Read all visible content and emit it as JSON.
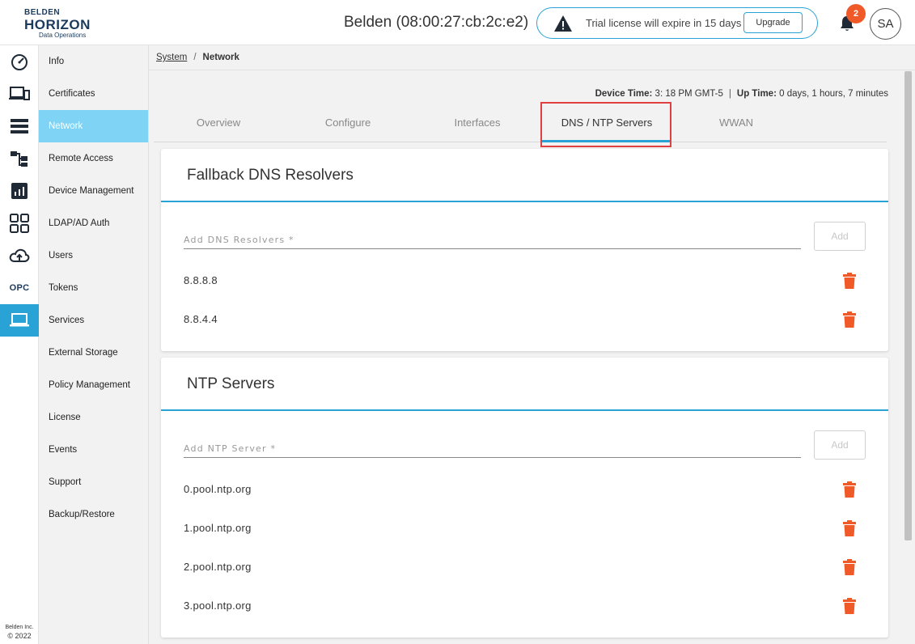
{
  "header": {
    "logo_line1": "BELDEN",
    "logo_line2": "HORIZON",
    "logo_tagline": "Data Operations",
    "device_title": "Belden (08:00:27:cb:2c:e2)",
    "trial_text": "Trial license will expire in 15 days",
    "upgrade_label": "Upgrade",
    "notification_count": "2",
    "avatar_initials": "SA",
    "accent_color": "#29a3d6",
    "badge_color": "#f05a28"
  },
  "rail": {
    "icons": [
      "dashboard-icon",
      "devices-icon",
      "list-icon",
      "topology-icon",
      "analytics-icon",
      "apps-grid-icon",
      "cloud-upload-icon",
      "opc-icon",
      "laptop-icon"
    ],
    "opc_label": "OPC",
    "footer_company": "Belden Inc.",
    "footer_copyright": "© 2022"
  },
  "sidebar": {
    "items": [
      {
        "label": "Info"
      },
      {
        "label": "Certificates"
      },
      {
        "label": "Network"
      },
      {
        "label": "Remote Access"
      },
      {
        "label": "Device Management"
      },
      {
        "label": "LDAP/AD Auth"
      },
      {
        "label": "Users"
      },
      {
        "label": "Tokens"
      },
      {
        "label": "Services"
      },
      {
        "label": "External Storage"
      },
      {
        "label": "Policy Management"
      },
      {
        "label": "License"
      },
      {
        "label": "Events"
      },
      {
        "label": "Support"
      },
      {
        "label": "Backup/Restore"
      }
    ],
    "active": "Network"
  },
  "breadcrumb": {
    "parent": "System",
    "separator": "/",
    "current": "Network"
  },
  "status": {
    "device_time_label": "Device Time:",
    "device_time_value": "3: 18 PM GMT-5",
    "separator": "|",
    "uptime_label": "Up Time:",
    "uptime_value": "0 days, 1 hours, 7 minutes"
  },
  "tabs": [
    {
      "label": "Overview"
    },
    {
      "label": "Configure"
    },
    {
      "label": "Interfaces"
    },
    {
      "label": "DNS / NTP Servers"
    },
    {
      "label": "WWAN"
    }
  ],
  "active_tab": "DNS / NTP Servers",
  "dns": {
    "title": "Fallback DNS Resolvers",
    "placeholder": "Add DNS Resolvers *",
    "add_label": "Add",
    "entries": [
      "8.8.8.8",
      "8.8.4.4"
    ]
  },
  "ntp": {
    "title": "NTP Servers",
    "placeholder": "Add NTP Server *",
    "add_label": "Add",
    "entries": [
      "0.pool.ntp.org",
      "1.pool.ntp.org",
      "2.pool.ntp.org",
      "3.pool.ntp.org"
    ]
  },
  "delete_color": "#f05a28"
}
